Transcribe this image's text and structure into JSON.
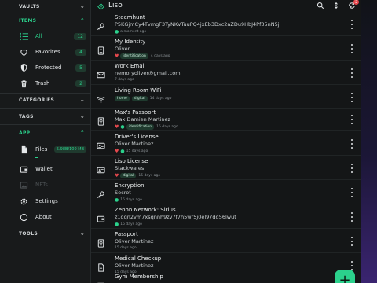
{
  "app": {
    "title": "Liso"
  },
  "sidebar": {
    "vaults_label": "VAULTS",
    "items_label": "ITEMS",
    "items": [
      {
        "label": "All",
        "count": "12",
        "icon": "list-icon"
      },
      {
        "label": "Favorites",
        "count": "4",
        "icon": "heart-icon"
      },
      {
        "label": "Protected",
        "count": "5",
        "icon": "shield-icon"
      },
      {
        "label": "Trash",
        "count": "2",
        "icon": "trash-icon"
      }
    ],
    "categories_label": "CATEGORIES",
    "tags_label": "TAGS",
    "app_label": "APP",
    "app_items": [
      {
        "label": "Files",
        "badge": "5.98B/100 MB",
        "icon": "file-icon"
      },
      {
        "label": "Wallet",
        "icon": "wallet-icon"
      },
      {
        "label": "NFTs",
        "icon": "image-icon"
      },
      {
        "label": "Settings",
        "icon": "gear-icon"
      },
      {
        "label": "About",
        "icon": "info-icon"
      }
    ],
    "tools_label": "TOOLS"
  },
  "header": {
    "notification_count": "2"
  },
  "list": [
    {
      "name": "Steemhunt",
      "sub": "P5KGjmCy4TvmgF3TyNKVTuuPQ4jxEb3Dxc2aZDu9HbJ4Pf35nN5j",
      "meta": "a moment ago",
      "shield": true,
      "icon": "key-icon"
    },
    {
      "name": "My Identity",
      "sub": "Oliver",
      "meta": "4 days ago",
      "heart": true,
      "tags": [
        "identification"
      ],
      "icon": "id-card-icon"
    },
    {
      "name": "Work Email",
      "sub": "nemoryoliver@gmail.com",
      "meta": "7 days ago",
      "icon": "mail-icon"
    },
    {
      "name": "Living Room WiFi",
      "sub": "",
      "meta": "14 days ago",
      "tags": [
        "home",
        "digital"
      ],
      "icon": "wifi-icon"
    },
    {
      "name": "Max's Passport",
      "sub": "Max Damien Martinez",
      "meta": "15 days ago",
      "heart": true,
      "shield": true,
      "tags": [
        "identification"
      ],
      "icon": "passport-icon"
    },
    {
      "name": "Driver's License",
      "sub": "Oliver Martinez",
      "meta": "15 days ago",
      "heart": true,
      "shield": true,
      "icon": "license-icon"
    },
    {
      "name": "Liso License",
      "sub": "Stackwares",
      "meta": "15 days ago",
      "heart": true,
      "tags": [
        "digital"
      ],
      "icon": "license-icon"
    },
    {
      "name": "Encryption",
      "sub": "Secret",
      "meta": "15 days ago",
      "shield": true,
      "icon": "key-icon"
    },
    {
      "name": "Zenon Network: Sirius",
      "sub": "z1qqn2vm7xsqnnh9zv7f7h5wr5j0el97dd56lwut",
      "meta": "15 days ago",
      "shield": true,
      "icon": "wallet-icon"
    },
    {
      "name": "Passport",
      "sub": "Oliver Martinez",
      "meta": "15 days ago",
      "icon": "passport-icon"
    },
    {
      "name": "Medical Checkup",
      "sub": "Oliver Martinez",
      "meta": "15 days ago",
      "icon": "document-icon"
    },
    {
      "name": "Gym Membership",
      "sub": "",
      "meta": "",
      "icon": "license-icon"
    }
  ],
  "colors": {
    "accent": "#2bd18c",
    "heart": "#e5484d",
    "background": "#141617"
  }
}
